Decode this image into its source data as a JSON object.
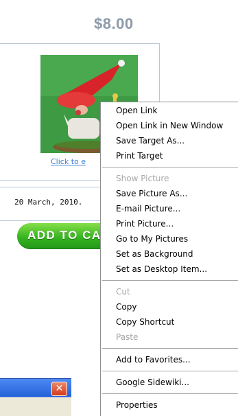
{
  "product": {
    "price": "$8.00",
    "click_link_text": "Click to e",
    "date": "20 March, 2010.",
    "add_to_cart_label": "ADD TO CA"
  },
  "context_menu": {
    "groups": [
      [
        {
          "label": "Open Link",
          "enabled": true
        },
        {
          "label": "Open Link in New Window",
          "enabled": true
        },
        {
          "label": "Save Target As...",
          "enabled": true
        },
        {
          "label": "Print Target",
          "enabled": true
        }
      ],
      [
        {
          "label": "Show Picture",
          "enabled": false
        },
        {
          "label": "Save Picture As...",
          "enabled": true
        },
        {
          "label": "E-mail Picture...",
          "enabled": true
        },
        {
          "label": "Print Picture...",
          "enabled": true
        },
        {
          "label": "Go to My Pictures",
          "enabled": true
        },
        {
          "label": "Set as Background",
          "enabled": true
        },
        {
          "label": "Set as Desktop Item...",
          "enabled": true
        }
      ],
      [
        {
          "label": "Cut",
          "enabled": false
        },
        {
          "label": "Copy",
          "enabled": true
        },
        {
          "label": "Copy Shortcut",
          "enabled": true
        },
        {
          "label": "Paste",
          "enabled": false
        }
      ],
      [
        {
          "label": "Add to Favorites...",
          "enabled": true
        }
      ],
      [
        {
          "label": "Google Sidewiki...",
          "enabled": true
        }
      ],
      [
        {
          "label": "Properties",
          "enabled": true
        }
      ]
    ]
  },
  "colors": {
    "price_text": "#8c9aaa",
    "link": "#3b7fd0",
    "add_button_green": "#36b51e",
    "photo_background": "#3f9a44",
    "gnome_hat": "#d8232a",
    "titlebar_blue": "#2360d9",
    "close_red": "#d2391a"
  },
  "icons": {
    "dialog_close": "close-icon"
  }
}
